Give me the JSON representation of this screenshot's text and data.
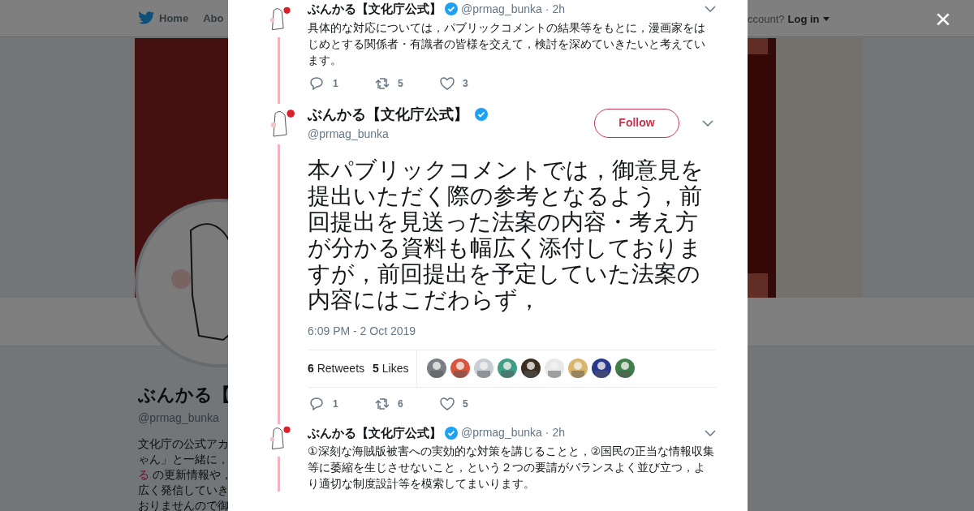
{
  "nav": {
    "items": [
      {
        "kind": "home",
        "label": "Home"
      },
      {
        "kind": "plain",
        "label": "Abo"
      }
    ],
    "account_prompt": "ccount?",
    "login": "Log in"
  },
  "profile": {
    "name": "ぶんかる【",
    "handle": "@prmag_bunka",
    "bio_lines": [
      {
        "text": "文化庁の公式アカ"
      },
      {
        "text": "ゃん」と一緒に，"
      },
      {
        "link": "る",
        "text": " の更新情報や，"
      },
      {
        "text": "広く発信していき"
      },
      {
        "text": "おりませんので御"
      }
    ]
  },
  "close": "×",
  "tweets": [
    {
      "kind": "reply",
      "name": "ぶんかる【文化庁公式】",
      "verified": true,
      "handle": "@prmag_bunka",
      "separator": "·",
      "time": "2h",
      "text": "具体的な対応については，パブリックコメントの結果等をもとに，漫画家をはじめとする関係者・有識者の皆様を交えて，検討を深めていきたいと考えています。",
      "actions": {
        "replies": "1",
        "retweets": "5",
        "likes": "3"
      }
    },
    {
      "kind": "focus",
      "name": "ぶんかる【文化庁公式】",
      "verified": true,
      "handle": "@prmag_bunka",
      "follow": "Follow",
      "text": "本パブリックコメントでは，御意見を提出いただく際の参考となるよう，前回提出を見送った法案の内容・考え方が分かる資料も幅広く添付しておりますが，前回提出を予定していた法案の内容にはこだわらず，",
      "timestamp": "6:09 PM - 2 Oct 2019",
      "stats": {
        "retweets_count": "6",
        "retweets_label": "Retweets",
        "likes_count": "5",
        "likes_label": "Likes",
        "likers": [
          {
            "color": "#7a7f86"
          },
          {
            "color": "#d9553f"
          },
          {
            "color": "#c9ced6"
          },
          {
            "color": "#3f9e88"
          },
          {
            "color": "#3b3020"
          },
          {
            "color": "#e8e8e8"
          },
          {
            "color": "#d8b56a"
          },
          {
            "color": "#283a8c"
          },
          {
            "color": "#3f7f4a"
          }
        ]
      },
      "actions": {
        "replies": "1",
        "retweets": "6",
        "likes": "5"
      }
    },
    {
      "kind": "reply",
      "name": "ぶんかる【文化庁公式】",
      "verified": true,
      "handle": "@prmag_bunka",
      "separator": "·",
      "time": "2h",
      "text": "①深刻な海賊版被害への実効的な対策を講じることと，②国民の正当な情報収集等に萎縮を生じさせないこと，という２つの要請がバランスよく並び立つ，より適切な制度設計等を模索してまいります。"
    }
  ]
}
